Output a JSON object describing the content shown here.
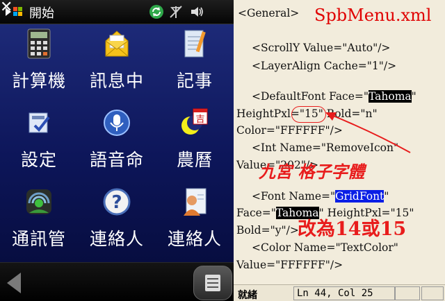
{
  "phone": {
    "start_label": "開始",
    "close_glyph": "✕",
    "tiles": [
      {
        "label": "計算機",
        "icon": "calculator-icon"
      },
      {
        "label": "訊息中",
        "icon": "envelope-icon"
      },
      {
        "label": "記事",
        "icon": "notes-icon"
      },
      {
        "label": "設定",
        "icon": "settings-icon"
      },
      {
        "label": "語音命",
        "icon": "voice-command-icon"
      },
      {
        "label": "農曆",
        "icon": "lunar-calendar-icon"
      },
      {
        "label": "通訊管",
        "icon": "comm-manager-icon"
      },
      {
        "label": "連絡人",
        "icon": "help-icon"
      },
      {
        "label": "連絡人",
        "icon": "contacts-icon"
      }
    ],
    "calendar_char": "吉"
  },
  "editor": {
    "file_title": "SpbMenu.xml",
    "lines": {
      "l1": "<General>",
      "l2": "<ScrollY Value=\"Auto\"/>",
      "l3": "<LayerAlign Cache=\"1\"/>",
      "l4a": "<DefaultFont Face=\"",
      "l4b": "Tahoma",
      "l4c": "\"",
      "l5": "HeightPxl=\"15\" Bold=\"n\"",
      "l6": "Color=\"FFFFFF\"/>",
      "l7": "<Int Name=\"RemoveIcon\"",
      "l8": "Value=\"202\"/>",
      "l9a": "<Font Name=\"",
      "l9b": "GridFont",
      "l9c": "\"",
      "l10a": "Face=\"",
      "l10b": "Tahoma",
      "l10c": "\" HeightPxl=\"15\"",
      "l11": "Bold=\"y\"/>",
      "l12": "<Color Name=\"TextColor\"",
      "l13": "Value=\"FFFFFF\"/>"
    },
    "notes": {
      "grid_font": "九宮 格子字體",
      "change": "改為14或15"
    },
    "status": {
      "ready": "就緒",
      "position": "Ln 44, Col 25"
    }
  }
}
